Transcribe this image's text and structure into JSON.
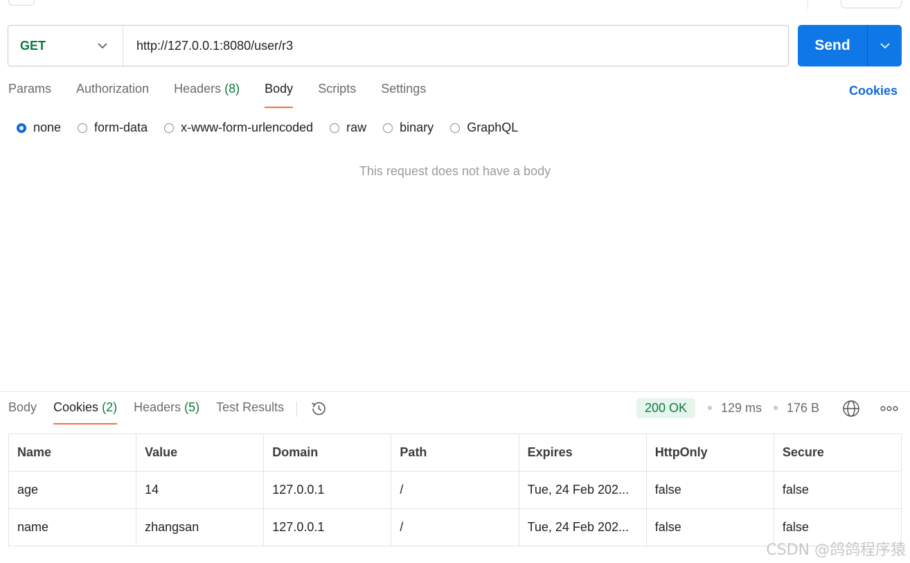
{
  "request": {
    "method": "GET",
    "url": "http://127.0.0.1:8080/user/r3",
    "send_label": "Send",
    "tabs": [
      {
        "label": "Params",
        "count": ""
      },
      {
        "label": "Authorization",
        "count": ""
      },
      {
        "label": "Headers",
        "count": "(8)"
      },
      {
        "label": "Body",
        "count": ""
      },
      {
        "label": "Scripts",
        "count": ""
      },
      {
        "label": "Settings",
        "count": ""
      }
    ],
    "active_tab": "Body",
    "cookies_link": "Cookies",
    "body_types": [
      "none",
      "form-data",
      "x-www-form-urlencoded",
      "raw",
      "binary",
      "GraphQL"
    ],
    "selected_body_type": "none",
    "empty_message": "This request does not have a body"
  },
  "response": {
    "tabs": [
      {
        "label": "Body",
        "count": ""
      },
      {
        "label": "Cookies",
        "count": "(2)"
      },
      {
        "label": "Headers",
        "count": "(5)"
      },
      {
        "label": "Test Results",
        "count": ""
      }
    ],
    "active_tab": "Cookies",
    "status": "200 OK",
    "time": "129 ms",
    "size": "176 B",
    "cookies_table": {
      "columns": [
        "Name",
        "Value",
        "Domain",
        "Path",
        "Expires",
        "HttpOnly",
        "Secure"
      ],
      "rows": [
        [
          "age",
          "14",
          "127.0.0.1",
          "/",
          "Tue, 24 Feb 202...",
          "false",
          "false"
        ],
        [
          "name",
          "zhangsan",
          "127.0.0.1",
          "/",
          "Tue, 24 Feb 202...",
          "false",
          "false"
        ]
      ]
    }
  },
  "watermark": "CSDN @鸽鸽程序猿",
  "colors": {
    "accent": "#0f77e6",
    "method_green": "#0b7a3e",
    "active_tab_underline": "#ff6c37"
  }
}
